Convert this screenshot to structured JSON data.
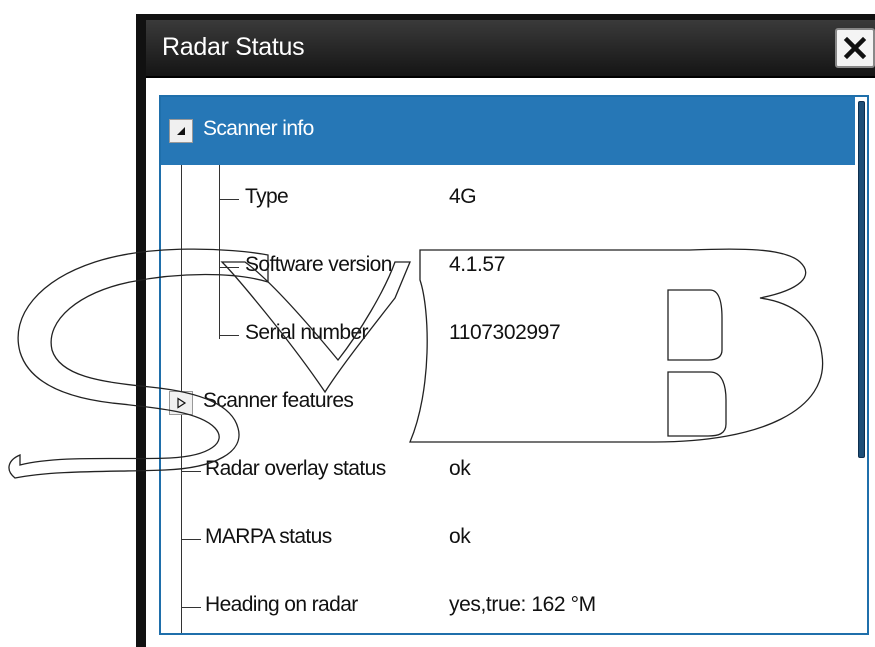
{
  "dialog": {
    "title": "Radar Status",
    "close_icon": "close-x-icon"
  },
  "rows": [
    {
      "label": "Scanner info",
      "value": "",
      "expander": "collapse-triangle-icon",
      "selected": true
    },
    {
      "label": "Type",
      "value": "4G"
    },
    {
      "label": "Software version",
      "value": "4.1.57"
    },
    {
      "label": "Serial number",
      "value": "1107302997"
    },
    {
      "label": "Scanner features",
      "value": "",
      "expander": "expand-triangle-icon"
    },
    {
      "label": "Radar overlay status",
      "value": "ok"
    },
    {
      "label": "MARPA status",
      "value": "ok"
    },
    {
      "label": "Heading on radar",
      "value": "yes,true: 162 °M"
    }
  ],
  "watermark": {
    "text": "SVB"
  },
  "colors": {
    "selection": "#2677b6",
    "panel_border": "#1f6fab",
    "titlebar": "#1c1c1c"
  }
}
